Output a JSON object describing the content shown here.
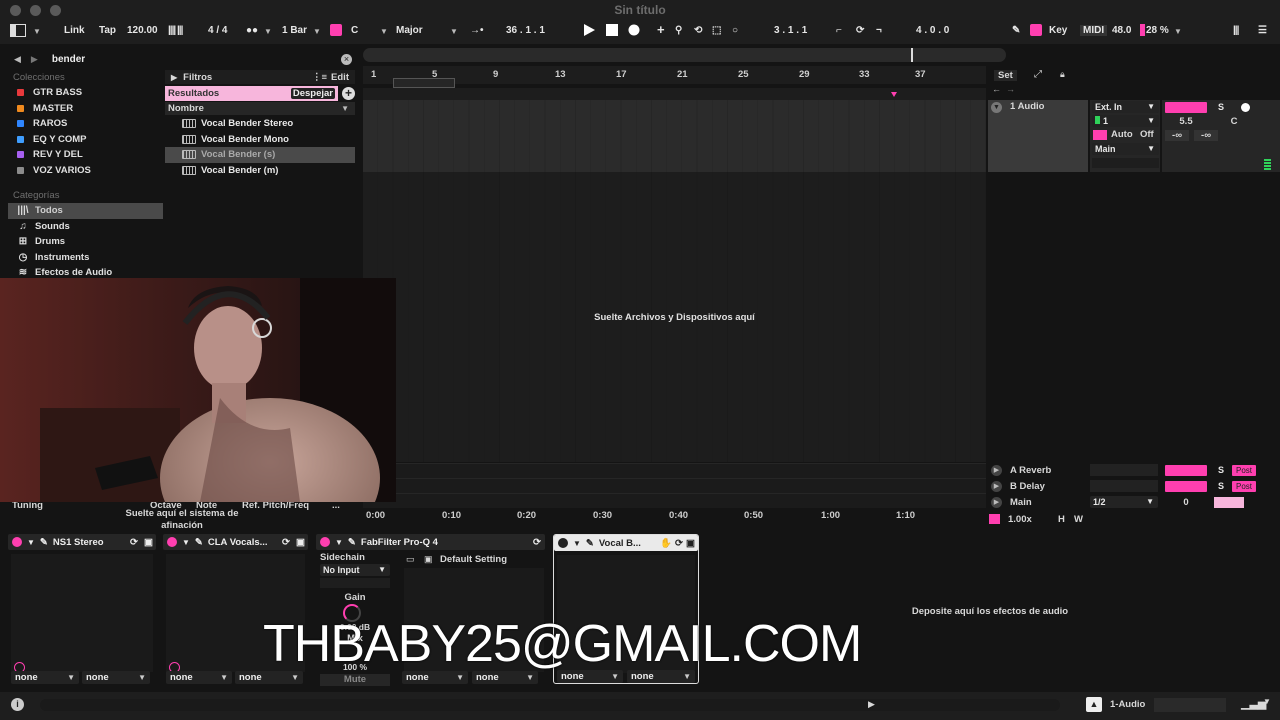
{
  "window": {
    "title": "Sin título"
  },
  "controlbar": {
    "link": "Link",
    "tap": "Tap",
    "tempo": "120.00",
    "signature": "4 / 4",
    "quantize": "1 Bar",
    "key": "C",
    "scale": "Major",
    "position": "36 .  1 .  1",
    "loop_start": "3 .  1 .  1",
    "loop_length": "4 .  0 .  0",
    "key_label": "Key",
    "midi_label": "MIDI",
    "cpu": "48.0",
    "cpu_pct": "28 %"
  },
  "browser": {
    "search_value": "bender",
    "collections_title": "Colecciones",
    "collections": [
      {
        "label": "GTR BASS",
        "color": "#e8393c"
      },
      {
        "label": "MASTER",
        "color": "#f08a1e"
      },
      {
        "label": "RAROS",
        "color": "#2f86ff"
      },
      {
        "label": "EQ Y COMP",
        "color": "#3f9eff"
      },
      {
        "label": "REV Y DEL",
        "color": "#a760f0"
      },
      {
        "label": "VOZ VARIOS",
        "color": "#8c8c8c"
      }
    ],
    "categories_title": "Categorías",
    "categories": [
      {
        "label": "Todos",
        "icon": "library-icon"
      },
      {
        "label": "Sounds",
        "icon": "music-note-icon"
      },
      {
        "label": "Drums",
        "icon": "drum-grid-icon"
      },
      {
        "label": "Instruments",
        "icon": "clock-icon"
      },
      {
        "label": "Efectos de Audio",
        "icon": "audio-fx-icon"
      }
    ],
    "filters_label": "Filtros",
    "edit_label": "Edit",
    "results_label": "Resultados",
    "clear_label": "Despejar",
    "name_header": "Nombre",
    "results": [
      {
        "label": "Vocal Bender Stereo"
      },
      {
        "label": "Vocal Bender Mono"
      },
      {
        "label": "Vocal Bender (s)"
      },
      {
        "label": "Vocal Bender (m)"
      }
    ]
  },
  "arrangement": {
    "bar_numbers": [
      "1",
      "5",
      "9",
      "13",
      "17",
      "21",
      "25",
      "29",
      "33",
      "37"
    ],
    "drop_hint": "Suelte Archivos y Dispositivos aquí",
    "time_marks": [
      "0:00",
      "0:10",
      "0:20",
      "0:30",
      "0:40",
      "0:50",
      "1:00",
      "1:10"
    ]
  },
  "mixer": {
    "set_label": "Set",
    "track_name": "1 Audio",
    "input_type": "Ext. In",
    "input_channel": "1",
    "monitor_auto": "Auto",
    "monitor_off": "Off",
    "output": "Main",
    "volume": "5.5",
    "pan": "C",
    "send_a_val": "-∞",
    "send_b_val": "-∞",
    "track_number": "1",
    "return_a": "A Reverb",
    "return_b": "B Delay",
    "main_label": "Main",
    "main_cue": "1/2",
    "main_value": "0",
    "solo_label": "S",
    "post_label": "Post",
    "zoom": "1.00x",
    "h_label": "H",
    "w_label": "W"
  },
  "tuning": {
    "label": "Tuning",
    "octave": "Octave",
    "note": "Note",
    "ref": "Ref. Pitch/Freq",
    "more": "...",
    "drop_hint": "Suelte aquí el sistema de afinación"
  },
  "devices": {
    "d1_name": "NS1 Stereo",
    "d2_name": "CLA Vocals...",
    "d3_name": "FabFilter Pro-Q 4",
    "d4_name": "Vocal B...",
    "sidechain": "Sidechain",
    "no_input": "No Input",
    "gain": "Gain",
    "gain_value": "0.00 dB",
    "mix": "Mix",
    "mix_value": "100 %",
    "mute": "Mute",
    "preset": "Default Setting",
    "none": "none",
    "drop_fx": "Deposite aquí los efectos de audio"
  },
  "status": {
    "track": "1-Audio"
  },
  "overlay": {
    "email": "THBABY25@GMAIL.COM"
  },
  "colors": {
    "accent": "#ff3fb0",
    "bg": "#141414",
    "panel": "#1e1e1e"
  }
}
